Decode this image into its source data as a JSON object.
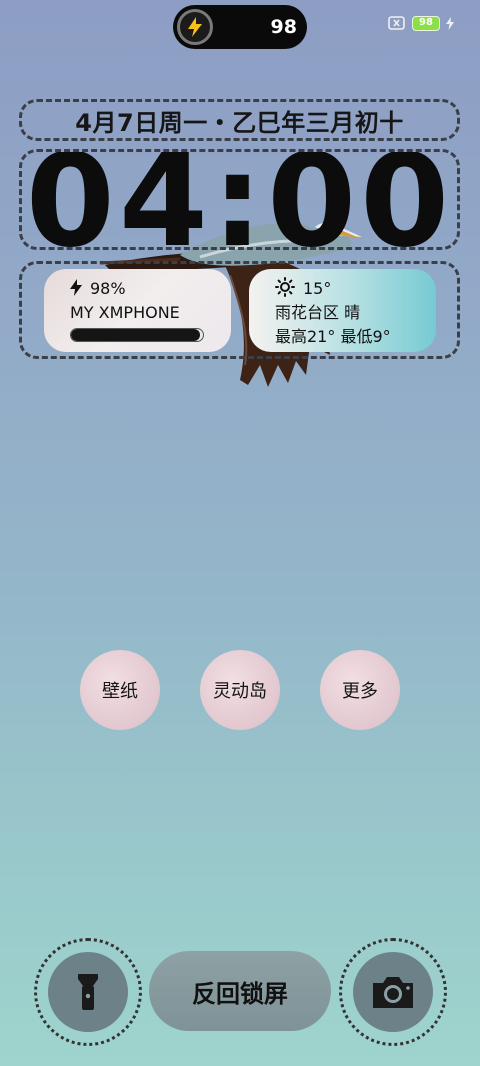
{
  "status_bar": {
    "island_value": "98",
    "battery_level": "98",
    "icons": [
      "battery-x-icon",
      "battery-icon",
      "charging-icon"
    ]
  },
  "lockscreen": {
    "date": "4月7日周一・乙巳年三月初十",
    "time": "04:00"
  },
  "battery_widget": {
    "percent_text": "98%",
    "device_name": "MY XMPHONE",
    "level": 0.98
  },
  "weather_widget": {
    "temperature": "15°",
    "location_weather": "雨花台区 晴",
    "high_low": "最高21° 最低9°"
  },
  "actions": {
    "wallpaper": "壁纸",
    "dynamic_island": "灵动岛",
    "more": "更多"
  },
  "bottom": {
    "back_lock": "反回锁屏",
    "left_icon": "flashlight-icon",
    "right_icon": "camera-icon"
  },
  "colors": {
    "accent_bolt": "#f6c21a",
    "battery_green": "#8be04a"
  }
}
